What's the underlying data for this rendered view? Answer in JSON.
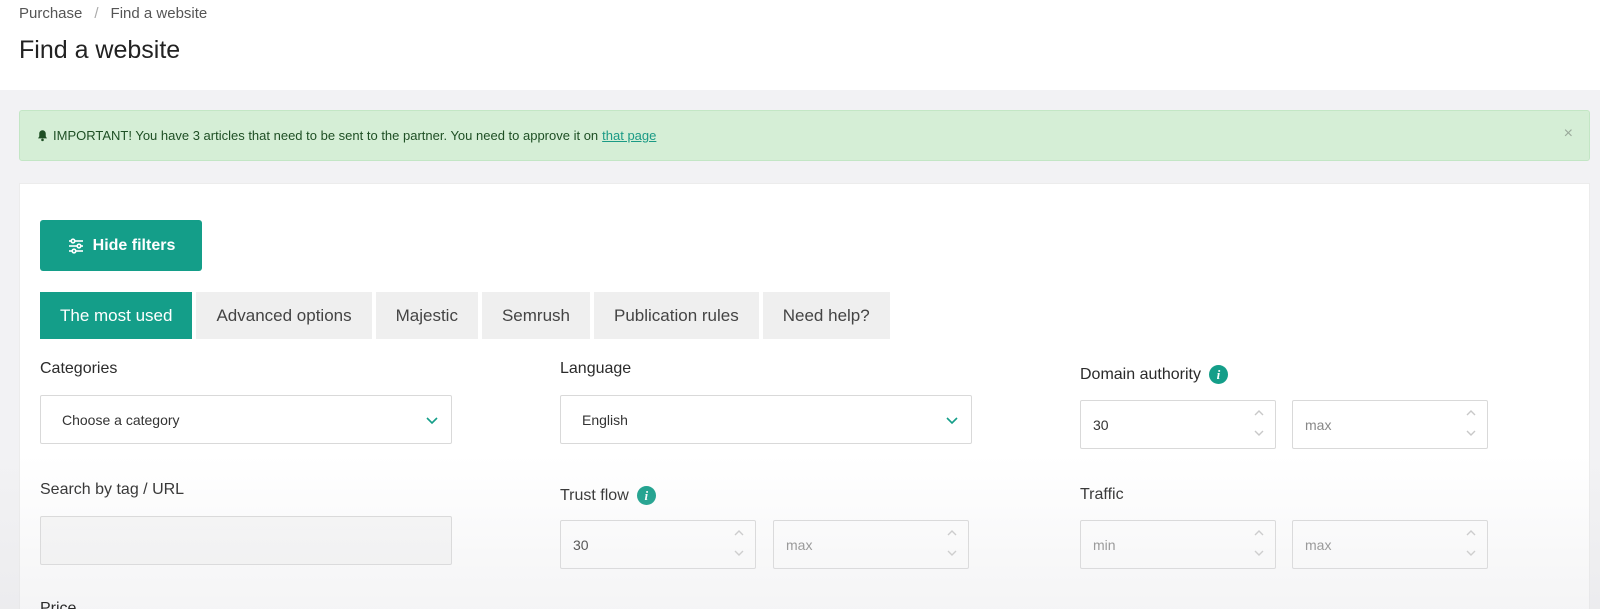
{
  "breadcrumb": {
    "items": [
      "Purchase",
      "Find a website"
    ],
    "separator": "/"
  },
  "page": {
    "title": "Find a website"
  },
  "alert": {
    "icon": "bell-icon",
    "text": "IMPORTANT! You have 3 articles that need to be sent to the partner. You need to approve it on",
    "link_text": "that page",
    "close_label": "×"
  },
  "filters": {
    "hide_button_label": "Hide filters",
    "tabs": [
      {
        "label": "The most used",
        "active": true
      },
      {
        "label": "Advanced options",
        "active": false
      },
      {
        "label": "Majestic",
        "active": false
      },
      {
        "label": "Semrush",
        "active": false
      },
      {
        "label": "Publication rules",
        "active": false
      },
      {
        "label": "Need help?",
        "active": false
      }
    ],
    "categories": {
      "label": "Categories",
      "value": "Choose a category"
    },
    "language": {
      "label": "Language",
      "value": "English"
    },
    "domain_authority": {
      "label": "Domain authority",
      "min_value": "30",
      "max_placeholder": "max"
    },
    "search": {
      "label": "Search by tag / URL",
      "value": ""
    },
    "trust_flow": {
      "label": "Trust flow",
      "min_value": "30",
      "max_placeholder": "max"
    },
    "traffic": {
      "label": "Traffic",
      "min_placeholder": "min",
      "max_placeholder": "max"
    },
    "next_label": "Price"
  },
  "colors": {
    "accent": "#149e89",
    "alert_bg": "#d5eed6",
    "page_bg": "#f2f2f4"
  }
}
